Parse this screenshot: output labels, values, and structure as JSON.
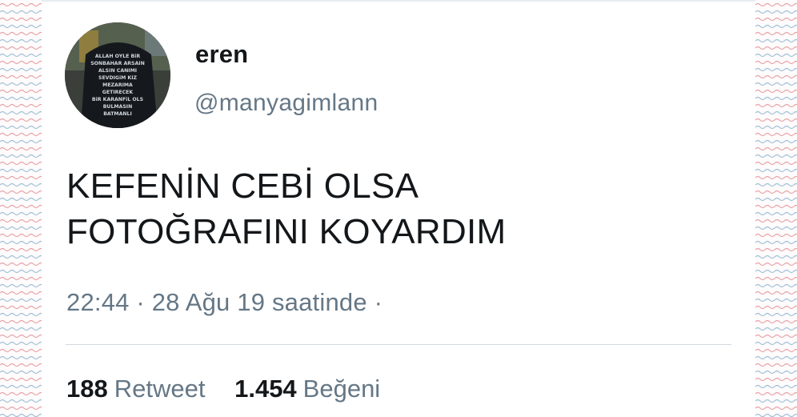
{
  "tweet": {
    "display_name": "eren",
    "handle": "@manyagimlann",
    "text_lines": [
      "KEFENİN CEBİ OLSA",
      "FOTOĞRAFINI KOYARDIM"
    ],
    "timestamp": "22:44 · 28 Ağu 19 saatinde ·",
    "retweets": {
      "count": "188",
      "label": "Retweet"
    },
    "likes": {
      "count": "1.454",
      "label": "Beğeni"
    }
  },
  "avatar": {
    "shirt_text": [
      "ALLAH OYLE BiR",
      "SONBAHAR ARSAIN",
      "ALSIN CANIMI",
      "SEVDIGiM KIZ",
      "MEZARIMA",
      "GETIRECEK",
      "BiR KARANFiL OLS",
      "BULMASIN",
      "BATMANLI"
    ]
  },
  "colors": {
    "text_primary": "#14171a",
    "text_secondary": "#657786",
    "divider": "#d3d9de",
    "pattern_red": "#e8a3a8",
    "pattern_blue": "#9fc0d8"
  },
  "icons": {
    "side_pattern": "wavy-lines-pattern"
  }
}
